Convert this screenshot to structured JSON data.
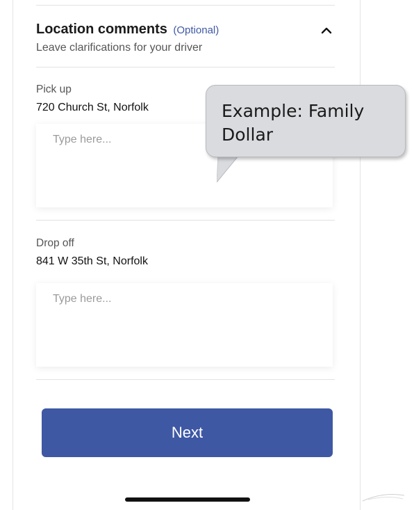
{
  "section": {
    "title": "Location comments",
    "optional_label": "(Optional)",
    "subtitle": "Leave clarifications for your driver",
    "collapse_icon": "chevron-up-icon"
  },
  "pickup": {
    "label": "Pick up",
    "address": "720 Church St, Norfolk",
    "placeholder": "Type here..."
  },
  "dropoff": {
    "label": "Drop off",
    "address": "841 W 35th St, Norfolk",
    "placeholder": "Type here..."
  },
  "tooltip": {
    "text_line1": "Example: Family",
    "text_line2": "Dollar"
  },
  "next_button": {
    "label": "Next"
  },
  "colors": {
    "accent": "#3f58a4",
    "tooltip_bg": "#d9dbdf"
  }
}
